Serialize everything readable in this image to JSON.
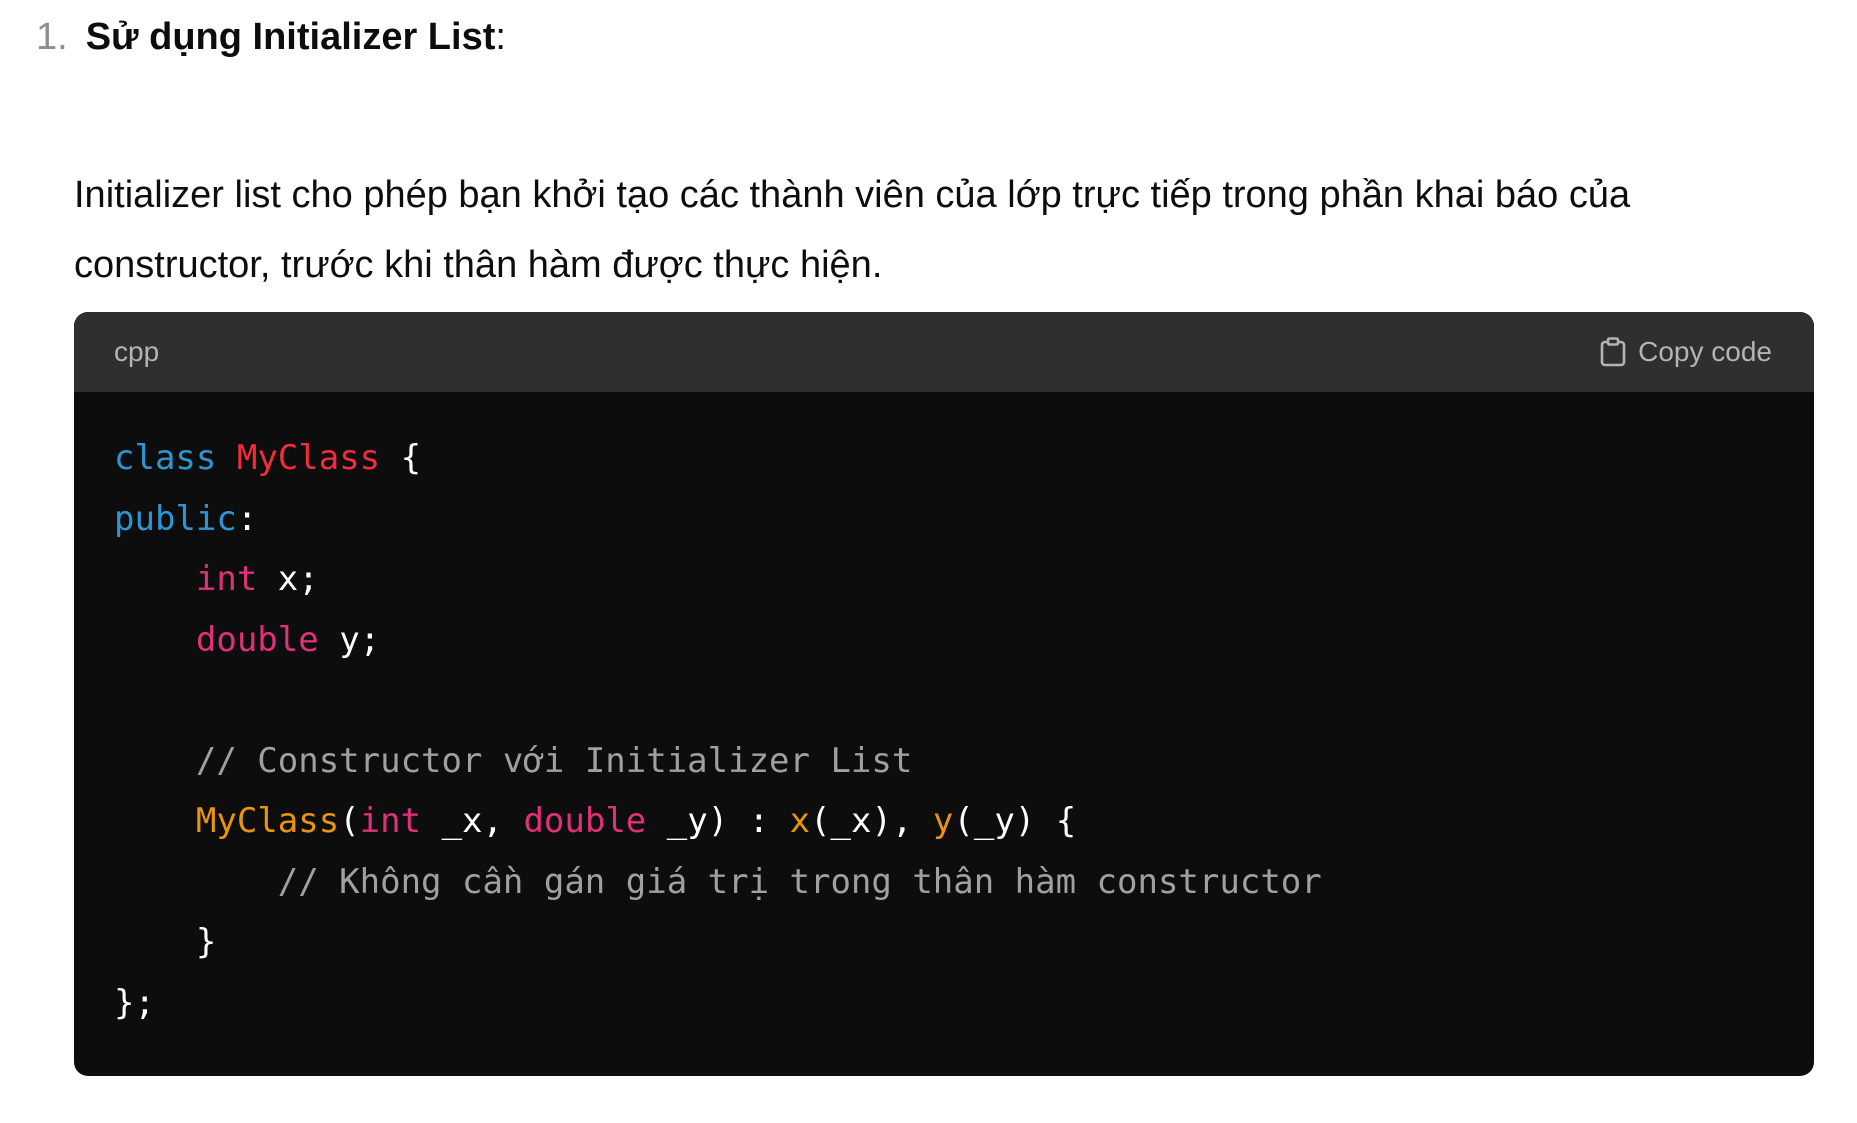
{
  "list": {
    "number": "1.",
    "heading": "Sử dụng Initializer List",
    "heading_suffix": ":"
  },
  "paragraph": "Initializer list cho phép bạn khởi tạo các thành viên của lớp trực tiếp trong phần khai báo của constructor, trước khi thân hàm được thực hiện.",
  "code_block": {
    "language": "cpp",
    "copy_label": "Copy code",
    "copy_icon": "clipboard-icon",
    "lines": [
      [
        {
          "t": "class",
          "c": "kw"
        },
        {
          "t": " ",
          "c": "plain"
        },
        {
          "t": "MyClass",
          "c": "class"
        },
        {
          "t": " {",
          "c": "plain"
        }
      ],
      [
        {
          "t": "public",
          "c": "kw"
        },
        {
          "t": ":",
          "c": "plain"
        }
      ],
      [
        {
          "t": "    ",
          "c": "plain"
        },
        {
          "t": "int",
          "c": "type"
        },
        {
          "t": " x;",
          "c": "plain"
        }
      ],
      [
        {
          "t": "    ",
          "c": "plain"
        },
        {
          "t": "double",
          "c": "type"
        },
        {
          "t": " y;",
          "c": "plain"
        }
      ],
      [],
      [
        {
          "t": "    ",
          "c": "plain"
        },
        {
          "t": "// Constructor với Initializer List",
          "c": "comment"
        }
      ],
      [
        {
          "t": "    ",
          "c": "plain"
        },
        {
          "t": "MyClass",
          "c": "fn"
        },
        {
          "t": "(",
          "c": "plain"
        },
        {
          "t": "int",
          "c": "type"
        },
        {
          "t": " _x, ",
          "c": "plain"
        },
        {
          "t": "double",
          "c": "type"
        },
        {
          "t": " _y) : ",
          "c": "plain"
        },
        {
          "t": "x",
          "c": "fn"
        },
        {
          "t": "(_x), ",
          "c": "plain"
        },
        {
          "t": "y",
          "c": "fn"
        },
        {
          "t": "(_y) {",
          "c": "plain"
        }
      ],
      [
        {
          "t": "        ",
          "c": "plain"
        },
        {
          "t": "// Không cần gán giá trị trong thân hàm constructor",
          "c": "comment"
        }
      ],
      [
        {
          "t": "    }",
          "c": "plain"
        }
      ],
      [
        {
          "t": "};",
          "c": "plain"
        }
      ]
    ]
  }
}
